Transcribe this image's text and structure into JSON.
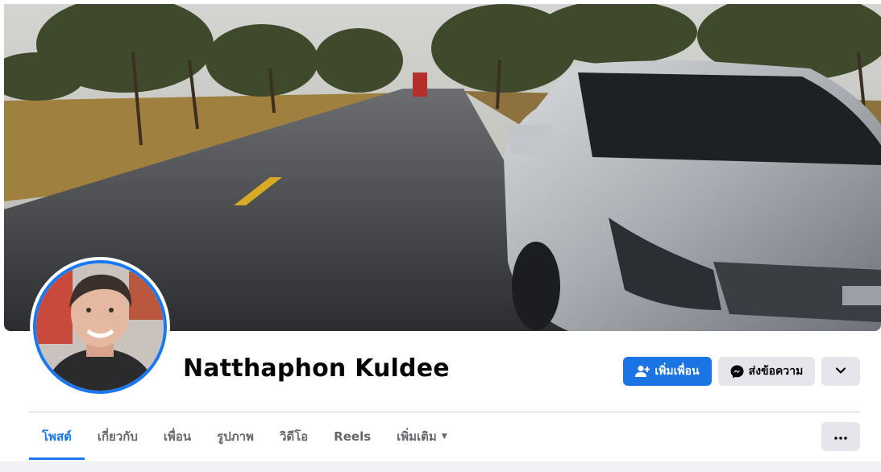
{
  "profile": {
    "name": "Natthaphon Kuldee"
  },
  "actions": {
    "add_friend_label": "เพิ่มเพื่อน",
    "message_label": "ส่งข้อความ"
  },
  "tabs": [
    {
      "label": "โพสต์",
      "active": true
    },
    {
      "label": "เกี่ยวกับ",
      "active": false
    },
    {
      "label": "เพื่อน",
      "active": false
    },
    {
      "label": "รูปภาพ",
      "active": false
    },
    {
      "label": "วิดีโอ",
      "active": false
    },
    {
      "label": "Reels",
      "active": false
    },
    {
      "label": "เพิ่มเติม",
      "active": false
    }
  ],
  "colors": {
    "accent": "#1877f2",
    "button_primary": "#1b74e4",
    "button_secondary": "#e4e6eb",
    "tab_inactive": "#65676b"
  },
  "icons": {
    "add_friend": "add-friend-icon",
    "message": "messenger-icon",
    "chevron": "chevron-down-icon",
    "more": "more-dots-icon",
    "tab_caret": "caret-down-icon"
  }
}
